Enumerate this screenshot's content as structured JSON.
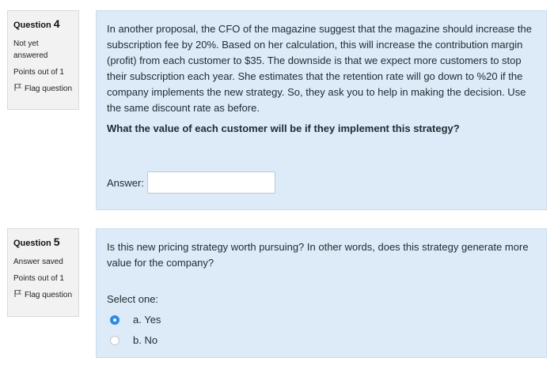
{
  "q4": {
    "label": "Question",
    "number": "4",
    "state": "Not yet answered",
    "grade": "Points out of 1",
    "flag": "Flag question",
    "text": "In another proposal, the CFO of the magazine suggest that the magazine should increase the subscription fee by 20%. Based on her calculation, this will increase the contribution margin (profit) from each customer to $35. The downside is that we expect more customers to stop their subscription each year. She estimates that the retention rate will go down to %20 if the company implements the new strategy. So, they ask you to help in making the decision. Use the same discount rate as before.",
    "bold_text": "What the value of each customer will be if they implement this strategy?",
    "answer_label": "Answer:",
    "answer_value": ""
  },
  "q5": {
    "label": "Question",
    "number": "5",
    "state": "Answer saved",
    "grade": "Points out of 1",
    "flag": "Flag question",
    "text": "Is this new pricing strategy worth pursuing? In other words, does this strategy generate more value for the company?",
    "select_label": "Select one:",
    "options": [
      {
        "label": "a. Yes",
        "selected": true
      },
      {
        "label": "b. No",
        "selected": false
      }
    ]
  },
  "colors": {
    "accent": "#2f8be2",
    "content_bg": "#dcebf7",
    "info_bg": "#f2f2f2"
  },
  "icons": {
    "flag": "flag-icon"
  }
}
